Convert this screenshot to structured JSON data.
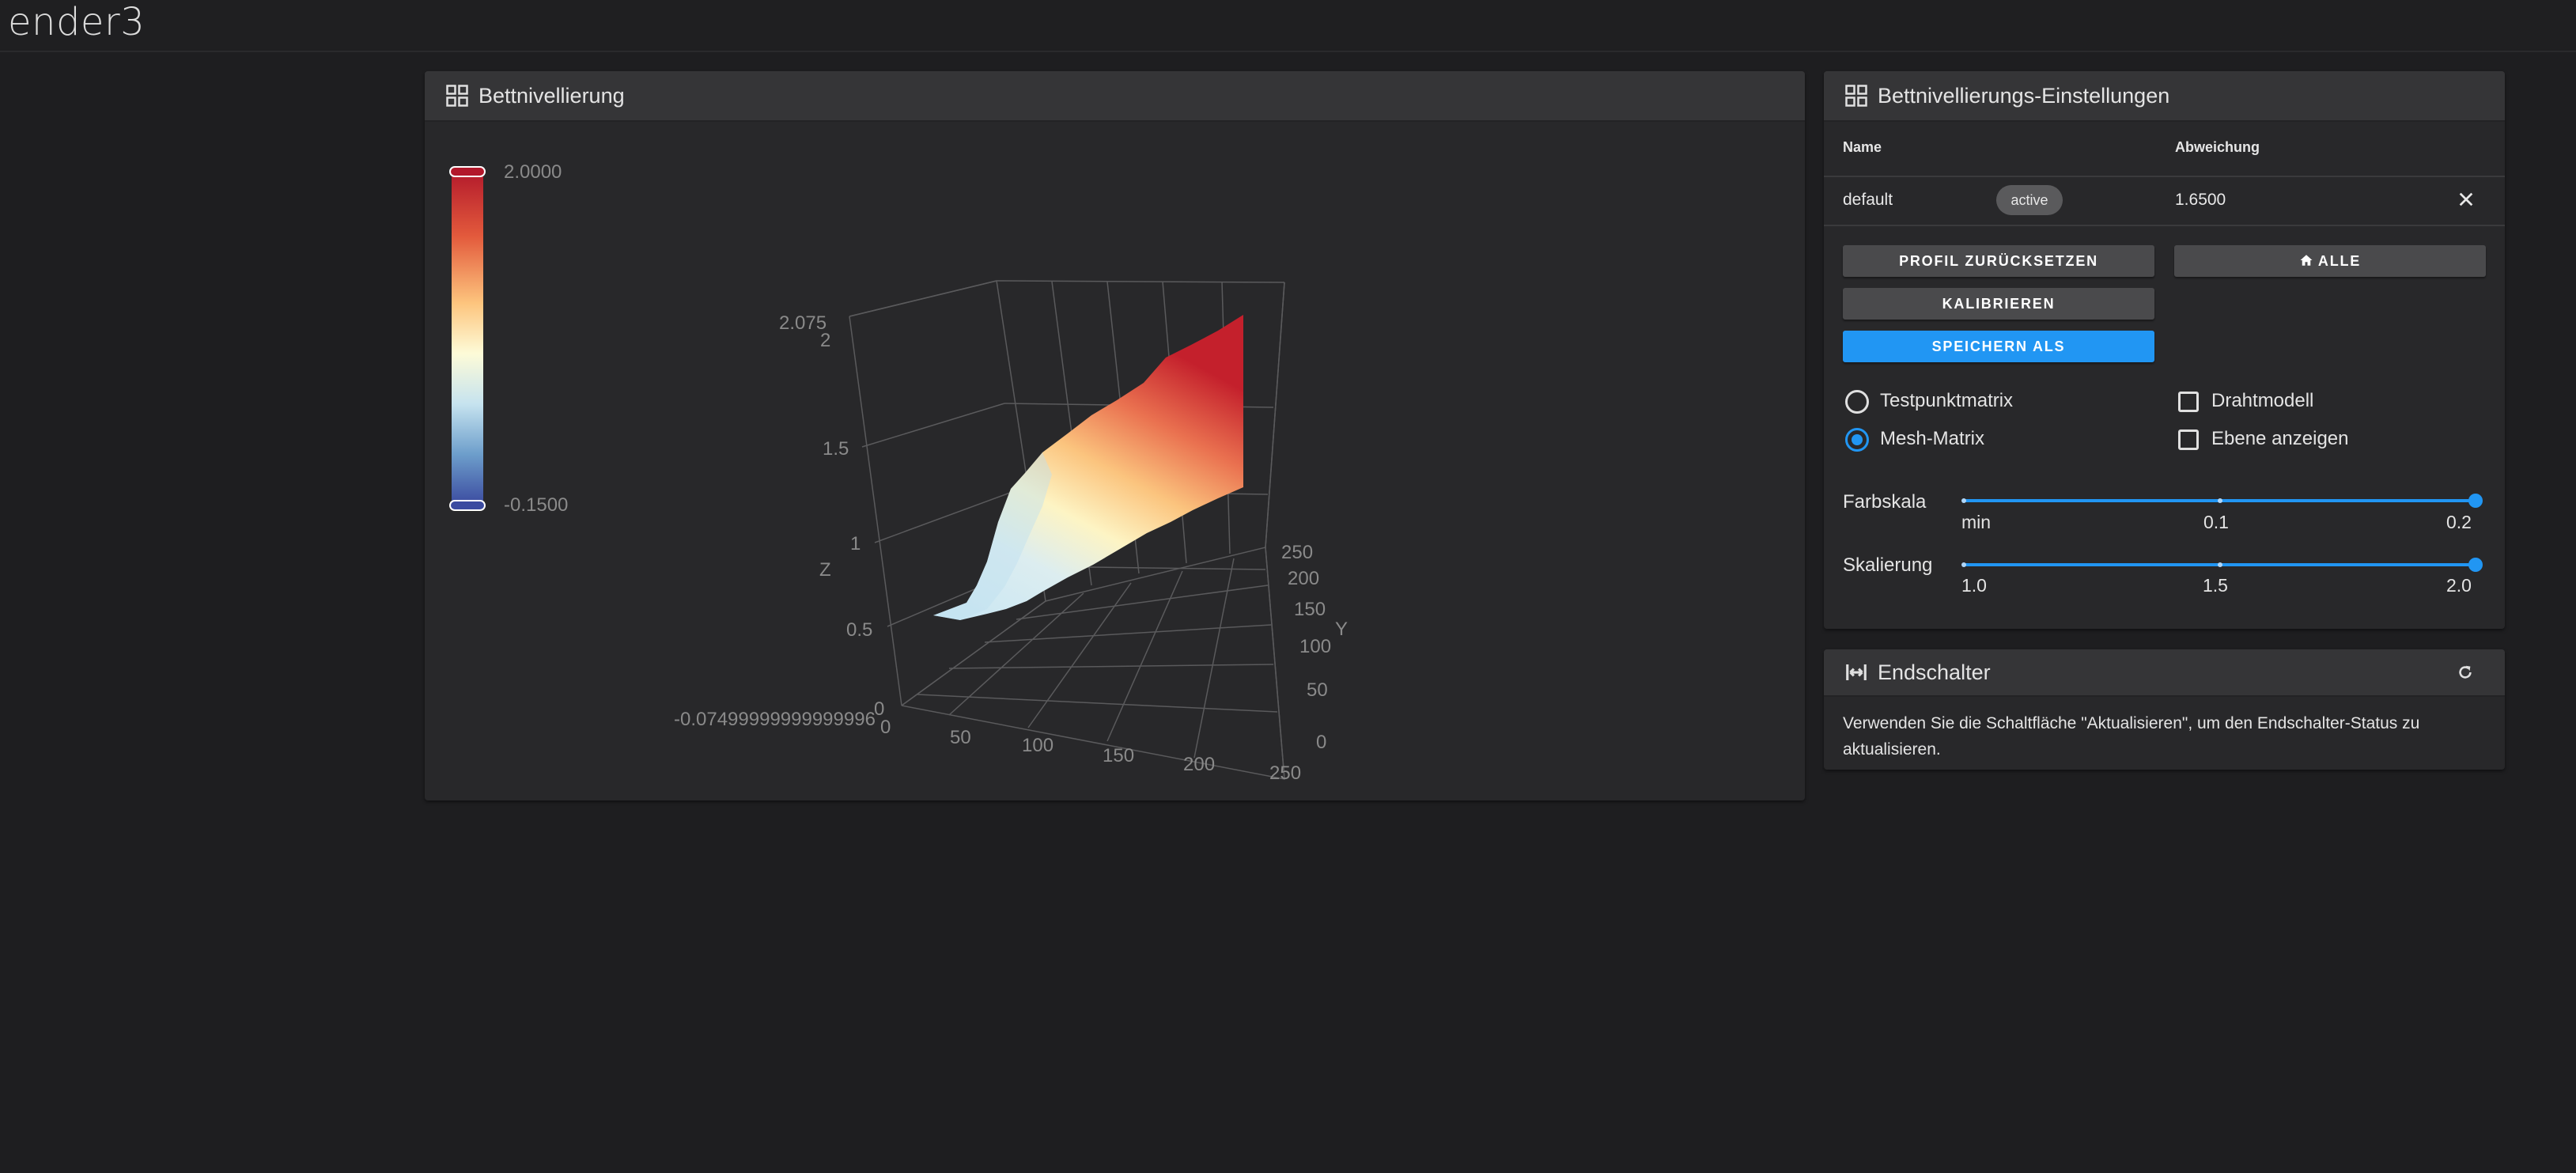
{
  "app": {
    "title": "ender3"
  },
  "mesh_card": {
    "title": "Bettnivellierung",
    "colorscale": {
      "max": "2.0000",
      "min": "-0.1500"
    },
    "axes": {
      "z_label": "Z",
      "y_label": "Y",
      "z_ticks": [
        "2.075",
        "2",
        "1.5",
        "1",
        "0.5",
        "0",
        "-0.07499999999999996"
      ],
      "x_ticks": [
        "0",
        "50",
        "100",
        "150",
        "200",
        "250"
      ],
      "y_ticks": [
        "250",
        "200",
        "150",
        "100",
        "50",
        "0"
      ]
    }
  },
  "settings_card": {
    "title": "Bettnivellierungs-Einstellungen",
    "table": {
      "headers": {
        "name": "Name",
        "deviation": "Abweichung"
      },
      "rows": [
        {
          "name": "default",
          "status": "active",
          "deviation": "1.6500"
        }
      ]
    },
    "buttons": {
      "reset_profile": "PROFIL ZURÜCKSETZEN",
      "home_all": "ALLE",
      "calibrate": "KALIBRIEREN",
      "save_as": "SPEICHERN ALS"
    },
    "options": {
      "probe_matrix": "Testpunktmatrix",
      "mesh_matrix": "Mesh-Matrix",
      "wireframe": "Drahtmodell",
      "show_plane": "Ebene anzeigen"
    },
    "sliders": {
      "color_scale": {
        "label": "Farbskala",
        "ticks": [
          "min",
          "0.1",
          "0.2"
        ],
        "value_fraction": 1.0
      },
      "scaling": {
        "label": "Skalierung",
        "ticks": [
          "1.0",
          "1.5",
          "2.0"
        ],
        "value_fraction": 1.0
      }
    }
  },
  "endstops_card": {
    "title": "Endschalter",
    "message": "Verwenden Sie die Schaltfläche \"Aktualisieren\", um den Endschalter-Status zu aktualisieren."
  }
}
